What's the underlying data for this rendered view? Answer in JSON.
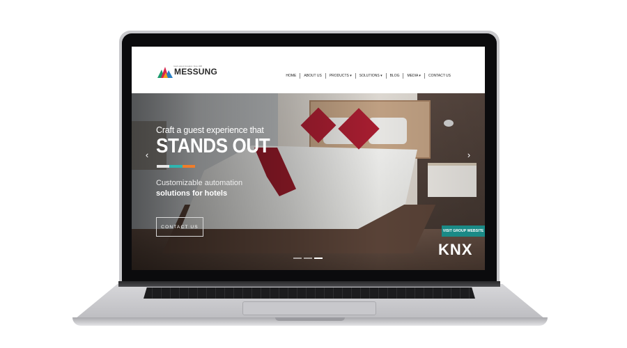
{
  "site": {
    "brand": "MESSUNG",
    "tagline": "Good Looks & Innovation • Since 1988",
    "colors": {
      "teal_button": "#1a8a86",
      "accent_white": "#e6e6e6",
      "accent_teal": "#2fb5b0",
      "accent_orange": "#f07d2a"
    }
  },
  "nav": {
    "items": [
      {
        "label": "HOME"
      },
      {
        "label": "ABOUT US"
      },
      {
        "label": "PRODUCTS ▾"
      },
      {
        "label": "SOLUTIONS ▾"
      },
      {
        "label": "BLOG"
      },
      {
        "label": "MEDIA ▾"
      },
      {
        "label": "CONTACT US"
      }
    ]
  },
  "hero": {
    "subtitle": "Craft a guest experience that",
    "title": "STANDS OUT",
    "desc_line1": "Customizable automation",
    "desc_line2": "solutions for hotels",
    "cta": "CONTACT US",
    "prev_icon": "‹",
    "next_icon": "›",
    "visit_button": "VISIT GROUP WEBSITE",
    "badge": "KNX"
  }
}
